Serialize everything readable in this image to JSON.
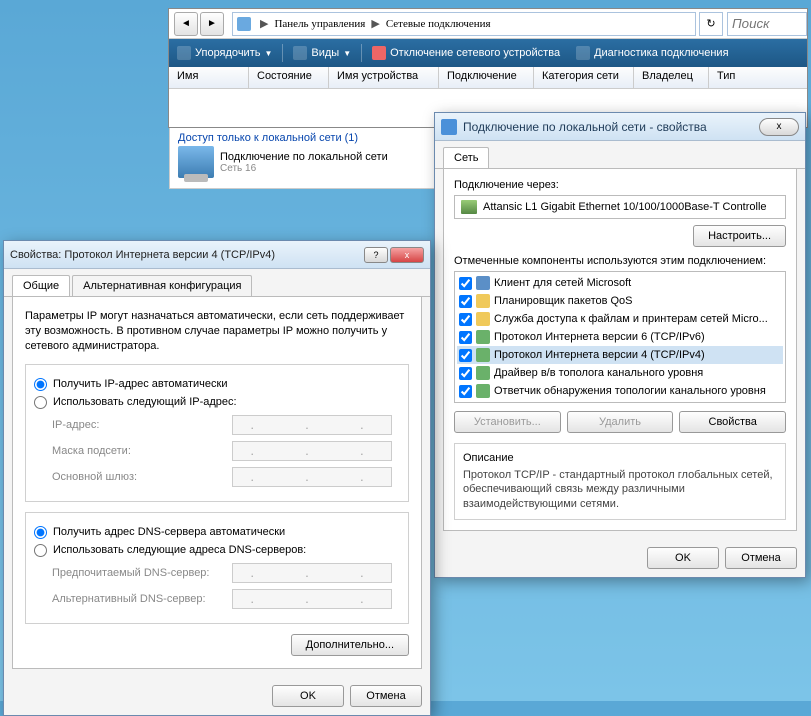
{
  "explorer": {
    "nav_back": "◄",
    "nav_fwd": "►",
    "breadcrumbs": [
      "Панель управления",
      "Сетевые подключения"
    ],
    "refresh": "↻",
    "search_placeholder": "Поиск",
    "toolbar": {
      "organize": "Упорядочить",
      "views": "Виды",
      "disable": "Отключение сетевого устройства",
      "diagnose": "Диагностика подключения"
    },
    "columns": [
      "Имя",
      "Состояние",
      "Имя устройства",
      "Подключение",
      "Категория сети",
      "Владелец",
      "Тип"
    ],
    "group_link": "Доступ только к локальной сети (1)",
    "conn": {
      "title": "Подключение по локальной сети",
      "sub": "Сеть 16"
    }
  },
  "props": {
    "title": "Подключение по локальной сети - свойства",
    "close": "x",
    "tab_net": "Сеть",
    "connect_via": "Подключение через:",
    "adapter": "Attansic L1 Gigabit Ethernet 10/100/1000Base-T Controlle",
    "configure": "Настроить...",
    "components_used": "Отмеченные компоненты используются этим подключением:",
    "items": [
      "Клиент для сетей Microsoft",
      "Планировщик пакетов QoS",
      "Служба доступа к файлам и принтерам сетей Micro...",
      "Протокол Интернета версии 6 (TCP/IPv6)",
      "Протокол Интернета версии 4 (TCP/IPv4)",
      "Драйвер в/в тополога канального уровня",
      "Ответчик обнаружения топологии канального уровня"
    ],
    "install": "Установить...",
    "uninstall": "Удалить",
    "properties": "Свойства",
    "description_hdr": "Описание",
    "description": "Протокол TCP/IP - стандартный протокол глобальных сетей, обеспечивающий связь между различными взаимодействующими сетями.",
    "ok": "OK",
    "cancel": "Отмена"
  },
  "ipv4": {
    "title": "Свойства: Протокол Интернета версии 4 (TCP/IPv4)",
    "help": "?",
    "close": "x",
    "tab_general": "Общие",
    "tab_alt": "Альтернативная конфигурация",
    "intro": "Параметры IP могут назначаться автоматически, если сеть поддерживает эту возможность. В противном случае параметры IP можно получить у сетевого администратора.",
    "ip_auto": "Получить IP-адрес автоматически",
    "ip_manual": "Использовать следующий IP-адрес:",
    "lbl_ip": "IP-адрес:",
    "lbl_mask": "Маска подсети:",
    "lbl_gw": "Основной шлюз:",
    "dns_auto": "Получить адрес DNS-сервера автоматически",
    "dns_manual": "Использовать следующие адреса DNS-серверов:",
    "lbl_dns1": "Предпочитаемый DNS-сервер:",
    "lbl_dns2": "Альтернативный DNS-сервер:",
    "ip_blank": ".   .   .",
    "advanced": "Дополнительно...",
    "ok": "OK",
    "cancel": "Отмена"
  }
}
